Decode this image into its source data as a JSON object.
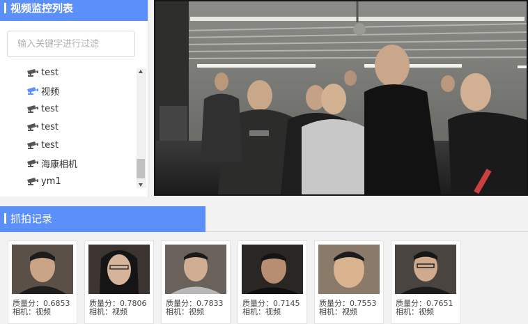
{
  "video_list": {
    "title": "视频监控列表",
    "filter_placeholder": "输入关键字进行过滤",
    "items": [
      {
        "label": "test"
      },
      {
        "label": "视频"
      },
      {
        "label": "test"
      },
      {
        "label": "test"
      },
      {
        "label": "test"
      },
      {
        "label": "海康相机"
      },
      {
        "label": "ym1"
      }
    ]
  },
  "capture": {
    "title": "抓拍记录",
    "records": [
      {
        "quality": "质量分：0.6853",
        "camera": "相机：视频"
      },
      {
        "quality": "质量分：0.7806",
        "camera": "相机：视频"
      },
      {
        "quality": "质量分：0.7833",
        "camera": "相机：视频"
      },
      {
        "quality": "质量分：0.7145",
        "camera": "相机：视频"
      },
      {
        "quality": "质量分：0.7553",
        "camera": "相机：视频"
      },
      {
        "quality": "质量分：0.7651",
        "camera": "相机：视频"
      }
    ]
  },
  "colors": {
    "accent": "#5b8ff9",
    "selected_camera_icon": "#5b8ff9",
    "camera_icon": "#555555"
  }
}
